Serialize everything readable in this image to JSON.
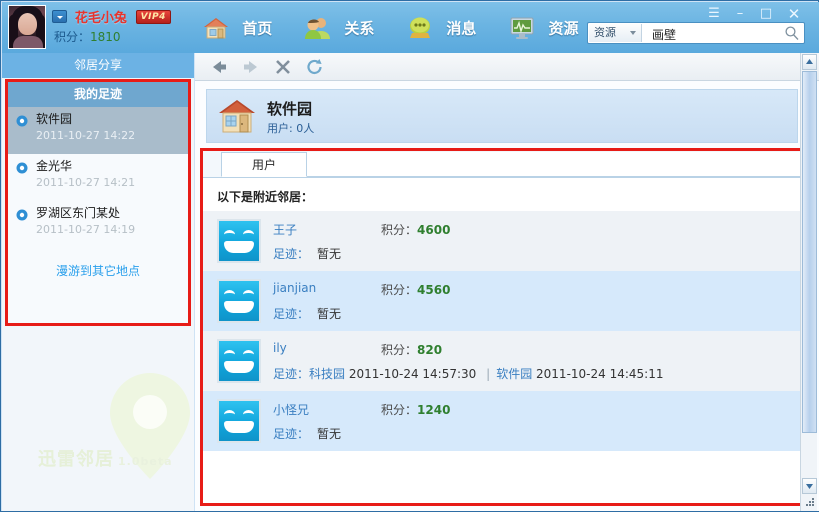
{
  "window": {
    "controls": [
      {
        "name": "menu",
        "glyph": "☰"
      },
      {
        "name": "minimize",
        "glyph": "–"
      },
      {
        "name": "maximize",
        "glyph": "□"
      },
      {
        "name": "close",
        "glyph": "✕"
      }
    ]
  },
  "account": {
    "nickname": "花毛小兔",
    "vip_badge": "VIP4",
    "points_label": "积分：",
    "points_value": "1810"
  },
  "nav": {
    "items": [
      {
        "label": "首页",
        "icon": "home-icon"
      },
      {
        "label": "关系",
        "icon": "people-icon"
      },
      {
        "label": "消息",
        "icon": "message-icon"
      },
      {
        "label": "资源",
        "icon": "monitor-icon"
      }
    ]
  },
  "search": {
    "scope": "资源",
    "value": "画壁",
    "placeholder": "画壁"
  },
  "sidebar": {
    "share_header": "邻居分享",
    "footprint_header": "我的足迹",
    "footprints": [
      {
        "place": "软件园",
        "time": "2011-10-27 14:22",
        "selected": true
      },
      {
        "place": "金光华",
        "time": "2011-10-27 14:21",
        "selected": false
      },
      {
        "place": "罗湖区东门某处",
        "time": "2011-10-27 14:19",
        "selected": false
      }
    ],
    "roam_link": "漫游到其它地点",
    "watermark": "迅雷邻居",
    "watermark_version": "1.0beta"
  },
  "toolbar": {
    "back": "←",
    "forward": "→",
    "stop": "✕",
    "refresh": "↺"
  },
  "place": {
    "title": "软件园",
    "subtitle": "用户: 0人",
    "icon": "house-icon"
  },
  "content": {
    "tab_label": "用户",
    "list_hint": "以下是附近邻居：",
    "points_label": "积分：",
    "trace_label": "足迹：",
    "none_text": "暂无",
    "users": [
      {
        "name": "王子",
        "points": "4600",
        "trace_none": true,
        "traces": []
      },
      {
        "name": "jianjian",
        "points": "4560",
        "trace_none": true,
        "traces": []
      },
      {
        "name": "ily",
        "points": "820",
        "trace_none": false,
        "traces": [
          {
            "place": "科技园",
            "time": "2011-10-24 14:57:30"
          },
          {
            "place": "软件园",
            "time": "2011-10-24 14:45:11"
          }
        ]
      },
      {
        "name": "小怪兄",
        "points": "1240",
        "trace_none": true,
        "traces": []
      }
    ]
  },
  "colors": {
    "brand_blue": "#6cb2e4",
    "highlight_red": "#e71c17",
    "points_green": "#2f7f2f",
    "link_blue": "#3a7fc1",
    "nickname_red": "#e8342d"
  }
}
